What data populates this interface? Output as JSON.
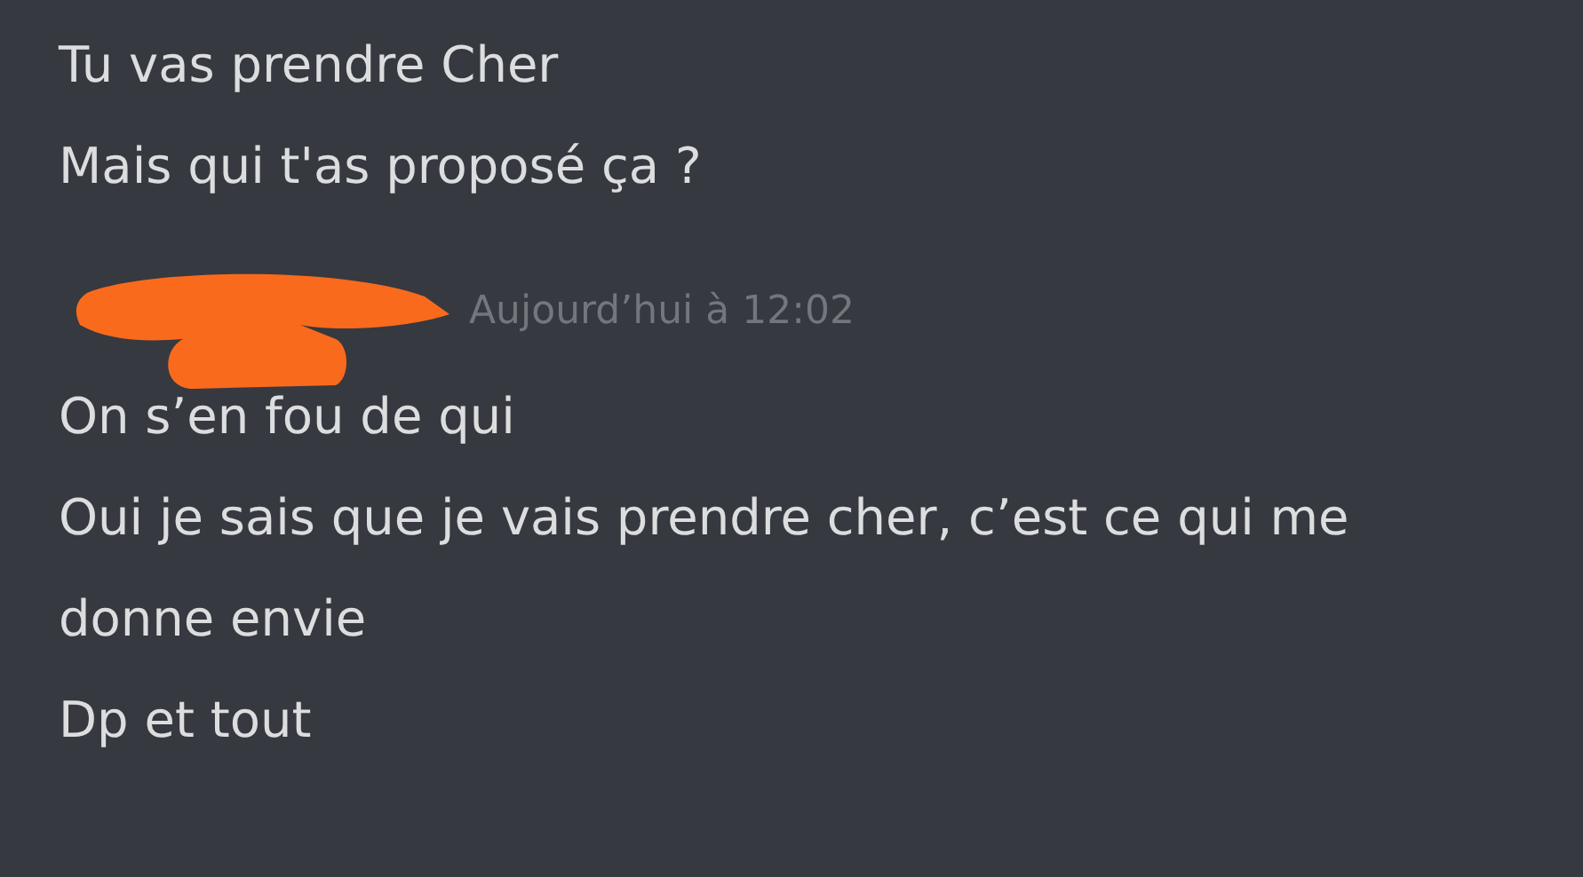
{
  "groups": [
    {
      "messages": [
        "Tu vas prendre Cher",
        "Mais qui t'as proposé ça ?"
      ]
    },
    {
      "header": {
        "author_redacted": true,
        "timestamp": "Aujourd’hui à 12:02"
      },
      "messages": [
        "On s’en fou de qui",
        "Oui je sais que je vais prendre cher, c’est ce qui me donne envie",
        "Dp et tout"
      ]
    }
  ]
}
